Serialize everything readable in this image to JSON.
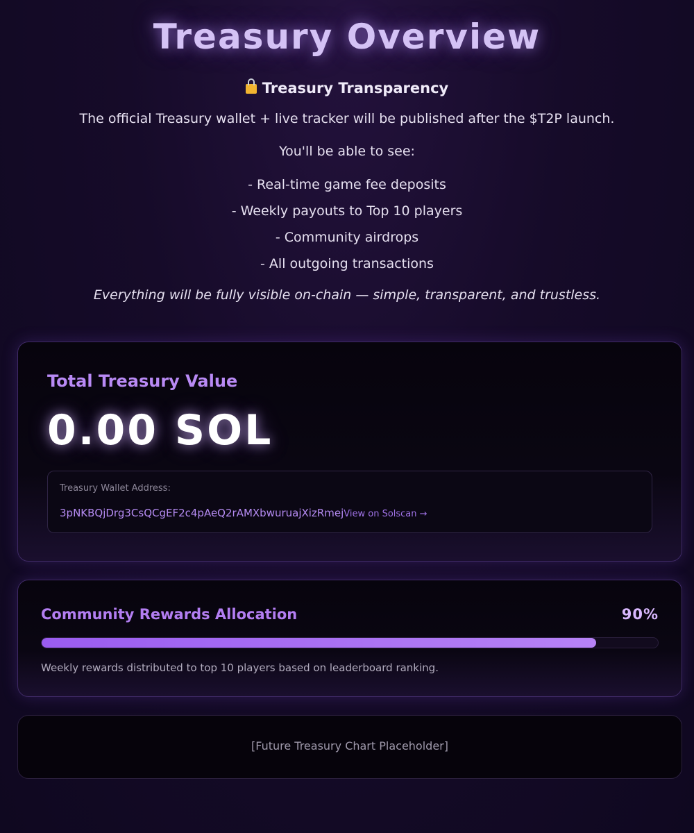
{
  "header": {
    "title": "Treasury Overview",
    "transparency_heading": "Treasury Transparency",
    "lock_icon": "lock-icon",
    "intro": "The official Treasury wallet + live tracker will be published after the $T2P launch.",
    "see_intro": "You'll be able to see:",
    "bullets": [
      "- Real-time game fee deposits",
      "- Weekly payouts to Top 10 players",
      "- Community airdrops",
      "- All outgoing transactions"
    ],
    "closing": "Everything will be fully visible on-chain — simple, transparent, and trustless."
  },
  "treasury": {
    "label": "Total Treasury Value",
    "amount": "0.00 SOL",
    "wallet_label": "Treasury Wallet Address:",
    "wallet_address": "3pNKBQjDrg3CsQCgEF2c4pAeQ2rAMXbwuruajXizRmej",
    "solscan_link": "View on Solscan →"
  },
  "rewards": {
    "title": "Community Rewards Allocation",
    "percent_label": "90%",
    "percent_value": 0.9,
    "description": "Weekly rewards distributed to top 10 players based on leaderboard ranking."
  },
  "chart_placeholder": {
    "text": "[Future Treasury Chart Placeholder]"
  },
  "colors": {
    "accent": "#b37ef2",
    "background": "#160b29",
    "progress_fill": "#9a5cf0"
  }
}
